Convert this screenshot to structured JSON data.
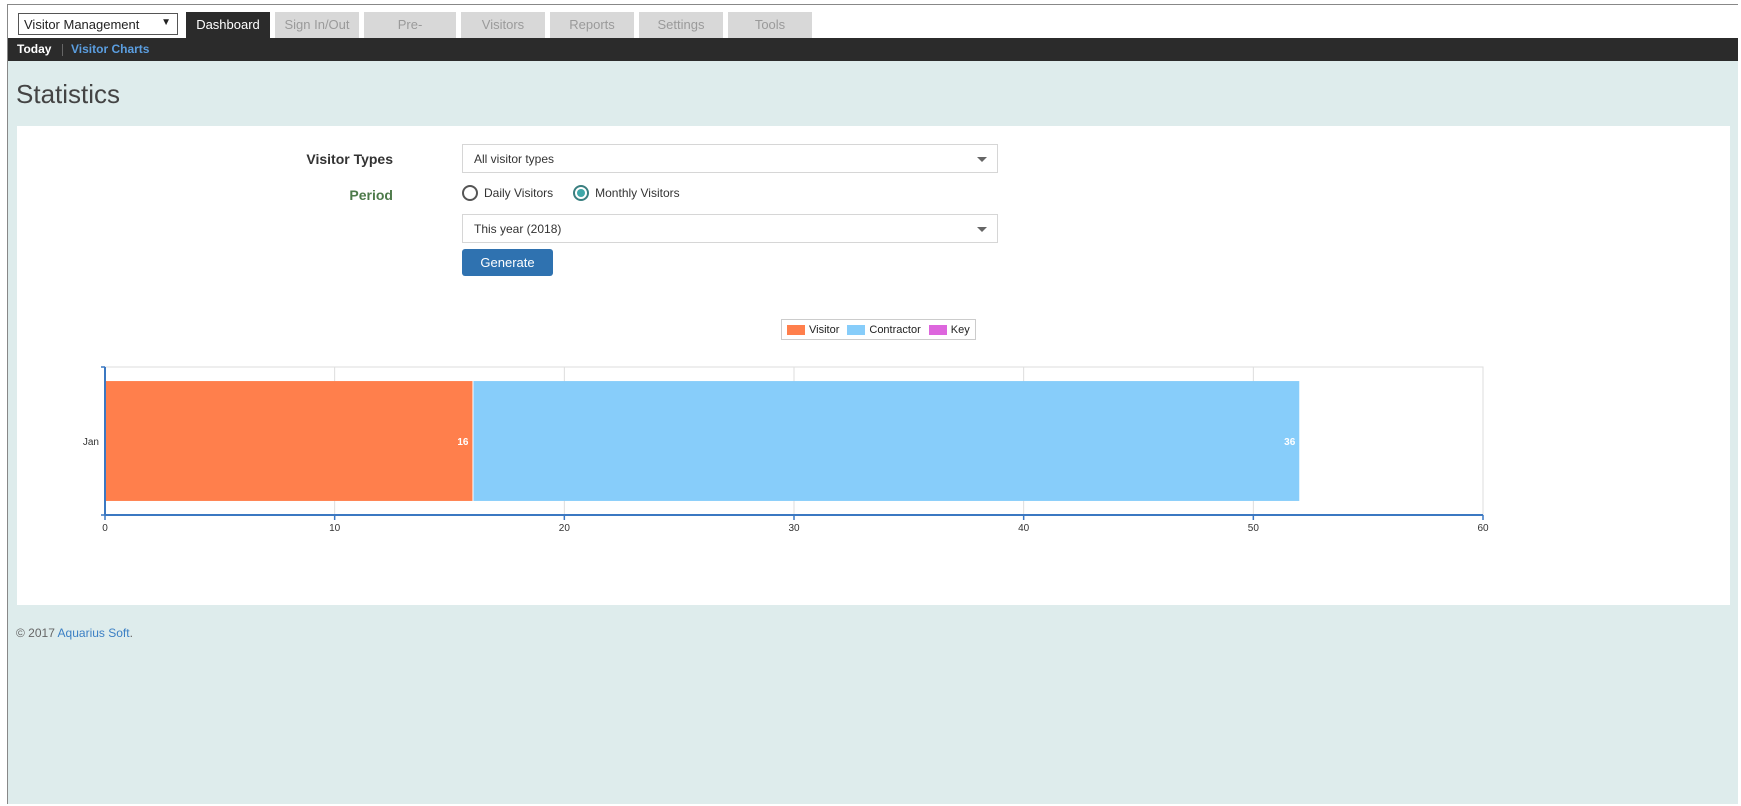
{
  "module_select": {
    "value": "Visitor Management"
  },
  "tabs": [
    {
      "label": "Dashboard",
      "active": true
    },
    {
      "label": "Sign In/Out"
    },
    {
      "label": "Pre-registrations"
    },
    {
      "label": "Visitors"
    },
    {
      "label": "Reports"
    },
    {
      "label": "Settings"
    },
    {
      "label": "Tools"
    }
  ],
  "subnav": {
    "today": "Today",
    "charts": "Visitor Charts"
  },
  "page_title": "Statistics",
  "form": {
    "visitor_types_label": "Visitor Types",
    "visitor_types_value": "All visitor types",
    "period_label": "Period",
    "daily_label": "Daily Visitors",
    "monthly_label": "Monthly Visitors",
    "period_value": "This year (2018)",
    "generate_label": "Generate"
  },
  "footer": {
    "copyright": "© 2017",
    "link": "Aquarius Soft",
    "suffix": "."
  },
  "chart_data": {
    "type": "bar",
    "orientation": "horizontal",
    "stacked": true,
    "categories": [
      "Jan"
    ],
    "series": [
      {
        "name": "Visitor",
        "values": [
          16
        ],
        "color": "#ff7f4c"
      },
      {
        "name": "Contractor",
        "values": [
          36
        ],
        "color": "#87cdfa"
      },
      {
        "name": "Key",
        "values": [
          0
        ],
        "color": "#dd66dd"
      }
    ],
    "xlim": [
      0,
      60
    ],
    "xticks": [
      0,
      10,
      20,
      30,
      40,
      50,
      60
    ],
    "grid": true,
    "legend": "top-center",
    "data_labels": true
  }
}
